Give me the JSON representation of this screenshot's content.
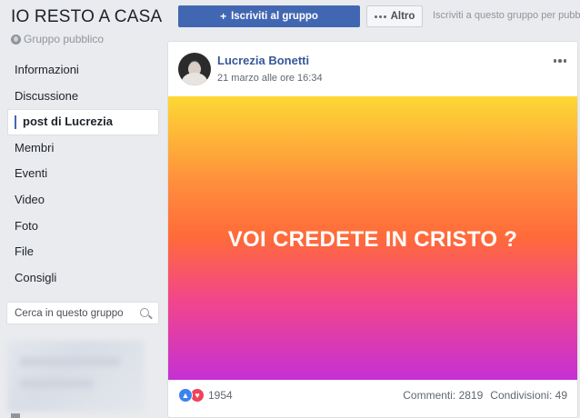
{
  "group": {
    "title": "IO RESTO A CASA",
    "type": "Gruppo pubblico"
  },
  "nav": {
    "items": [
      {
        "label": "Informazioni"
      },
      {
        "label": "Discussione"
      },
      {
        "label": "post di Lucrezia",
        "active": true
      },
      {
        "label": "Membri"
      },
      {
        "label": "Eventi"
      },
      {
        "label": "Video"
      },
      {
        "label": "Foto"
      },
      {
        "label": "File"
      },
      {
        "label": "Consigli"
      }
    ]
  },
  "search": {
    "placeholder": "Cerca in questo gruppo",
    "icon": "search-icon"
  },
  "actions": {
    "join_label": "Iscriviti al gruppo",
    "more_label": "Altro",
    "note": "Iscriviti a questo gruppo per pubblicare"
  },
  "post": {
    "author": "Lucrezia Bonetti",
    "timestamp": "21 marzo alle ore 16:34",
    "image_text": "VOI CREDETE IN CRISTO ?",
    "reaction_count": "1954",
    "comments": "Commenti: 2819",
    "shares": "Condivisioni: 49"
  },
  "colors": {
    "accent": "#4267b2",
    "link": "#365899",
    "background": "#e9ebee",
    "gradient_top": "#fdd835",
    "gradient_bottom": "#c530d4"
  }
}
